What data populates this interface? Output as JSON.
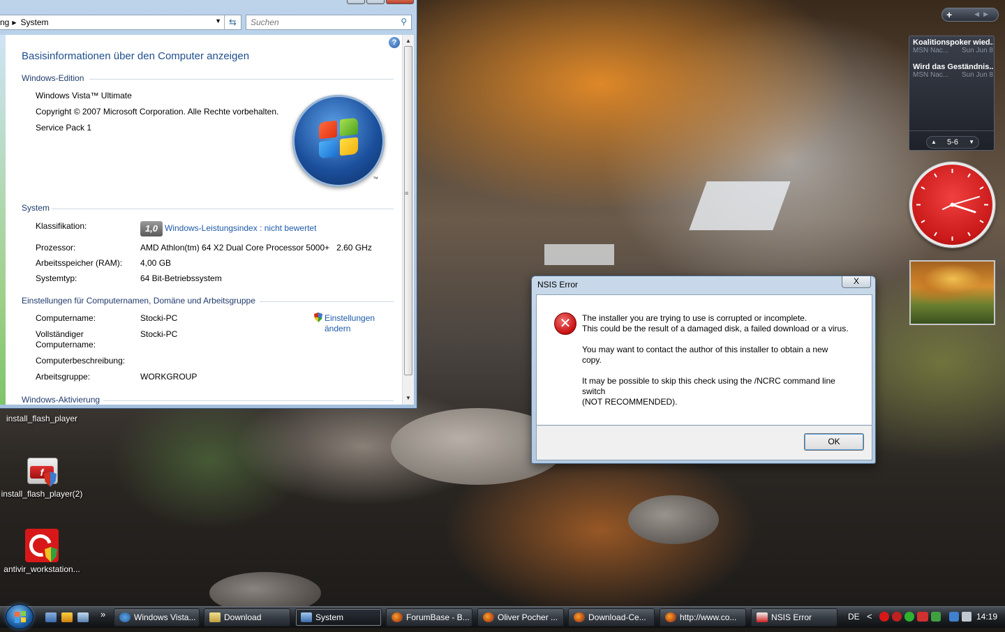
{
  "system_window": {
    "breadcrumb_prev": "ng",
    "breadcrumb_current": "System",
    "search_placeholder": "Suchen",
    "page_title": "Basisinformationen über den Computer anzeigen",
    "edition": {
      "header": "Windows-Edition",
      "name": "Windows Vista™ Ultimate",
      "copyright": "Copyright © 2007 Microsoft Corporation. Alle Rechte vorbehalten.",
      "service_pack": "Service Pack 1",
      "logo_tm": "™"
    },
    "system": {
      "header": "System",
      "rating_label": "Klassifikation:",
      "rating_badge": "1,0",
      "rating_link": "Windows-Leistungsindex : nicht bewertet",
      "processor_label": "Prozessor:",
      "processor_value": "AMD Athlon(tm) 64 X2 Dual Core Processor 5000+   2.60 GHz",
      "ram_label": "Arbeitsspeicher (RAM):",
      "ram_value": "4,00 GB",
      "type_label": "Systemtyp:",
      "type_value": "64 Bit-Betriebssystem"
    },
    "computer": {
      "header": "Einstellungen für Computernamen, Domäne und Arbeitsgruppe",
      "name_label": "Computername:",
      "name_value": "Stocki-PC",
      "fullname_label_1": "Vollständiger",
      "fullname_label_2": "Computername:",
      "fullname_value": "Stocki-PC",
      "description_label": "Computerbeschreibung:",
      "workgroup_label": "Arbeitsgruppe:",
      "workgroup_value": "WORKGROUP",
      "change_link_1": "Einstellungen",
      "change_link_2": "ändern"
    },
    "activation_header": "Windows-Aktivierung"
  },
  "desktop_icons": [
    {
      "label": "install_flash_player"
    },
    {
      "label": "install_flash_player(2)"
    },
    {
      "label": "antivir_workstation..."
    }
  ],
  "gadgets": {
    "news": [
      {
        "headline": "Koalitionspoker wied...",
        "source": "MSN Nac...",
        "date": "Sun Jun 8"
      },
      {
        "headline": "Wird das Geständnis...",
        "source": "MSN Nac...",
        "date": "Sun Jun 8"
      }
    ],
    "news_page": "5-6"
  },
  "nsis_dialog": {
    "title": "NSIS Error",
    "close_label": "X",
    "line1": "The installer you are trying to use is corrupted or incomplete.",
    "line2": "This could be the result of a damaged disk, a failed download or a virus.",
    "line3": "You may want to contact the author of this installer to obtain a new",
    "line4": "copy.",
    "line5": "It may be possible to skip this check using the /NCRC command line",
    "line6": "switch",
    "line7": "(NOT RECOMMENDED).",
    "ok_label": "OK"
  },
  "taskbar": {
    "buttons": [
      {
        "label": "Windows Vista..."
      },
      {
        "label": "Download"
      },
      {
        "label": "System"
      },
      {
        "label": "ForumBase - B..."
      },
      {
        "label": "Oliver Pocher ..."
      },
      {
        "label": "Download-Ce..."
      },
      {
        "label": "http://www.co..."
      },
      {
        "label": "NSIS Error"
      }
    ],
    "overflow": "»",
    "language": "DE",
    "tray_chevron": "<",
    "time": "14:19"
  },
  "colors": {
    "link_blue": "#1e5aa8",
    "title_blue": "#1e4e8c",
    "error_red": "#c81010",
    "clock_red": "#d42020"
  }
}
